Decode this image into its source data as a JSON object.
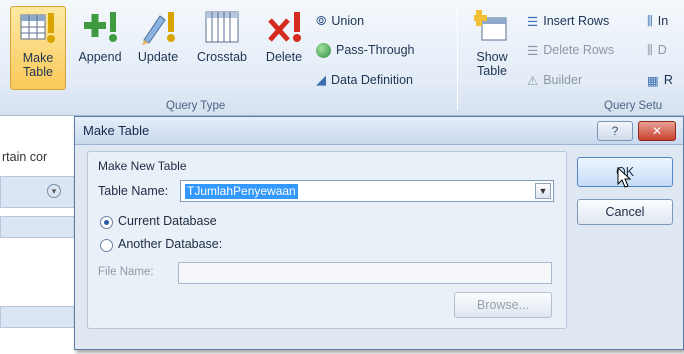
{
  "ribbon": {
    "make_table": "Make\nTable",
    "append": "Append",
    "update": "Update",
    "crosstab": "Crosstab",
    "delete": "Delete",
    "union": "Union",
    "pass_through": "Pass-Through",
    "data_definition": "Data Definition",
    "group_query_type": "Query Type",
    "show_table": "Show\nTable",
    "insert_rows": "Insert Rows",
    "delete_rows": "Delete Rows",
    "builder": "Builder",
    "group_query_setup": "Query Setu",
    "insert_cut": "In",
    "delete_cut": "D",
    "r_cut": "R"
  },
  "background": {
    "partial_text": "rtain cor"
  },
  "dialog": {
    "title": "Make Table",
    "help_glyph": "?",
    "close_glyph": "✕",
    "section_label": "Make New Table",
    "table_name_label": "Table Name:",
    "table_name_value": "TJumlahPenyewaan",
    "current_database": "Current Database",
    "another_database": "Another Database:",
    "file_name_label": "File Name:",
    "file_name_value": "",
    "browse_label": "Browse...",
    "ok_label": "OK",
    "cancel_label": "Cancel",
    "selected_database": "current"
  }
}
